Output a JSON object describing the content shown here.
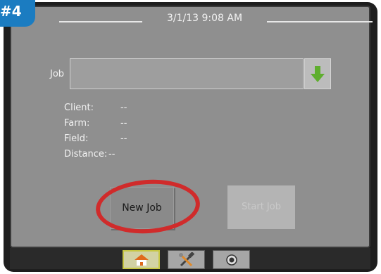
{
  "step_badge": "#4",
  "header": {
    "datetime": "3/1/13 9:08 AM"
  },
  "job": {
    "label": "Job",
    "value": "",
    "download_icon": "green-down-arrow-icon"
  },
  "info": [
    {
      "label": "Client:",
      "value": "--"
    },
    {
      "label": "Farm:",
      "value": "--"
    },
    {
      "label": "Field:",
      "value": "--"
    },
    {
      "label": "Distance:",
      "value": "--"
    }
  ],
  "buttons": {
    "new_job": "New Job",
    "start_job": "Start Job"
  },
  "taskbar": {
    "tabs": [
      "home-icon",
      "tools-icon",
      "camera-icon"
    ],
    "active": "home-icon"
  },
  "colors": {
    "highlight": "#d02b2b",
    "badge": "#1b7cc1",
    "active_tab": "#c7c744",
    "download_arrow": "#5fae2e"
  }
}
